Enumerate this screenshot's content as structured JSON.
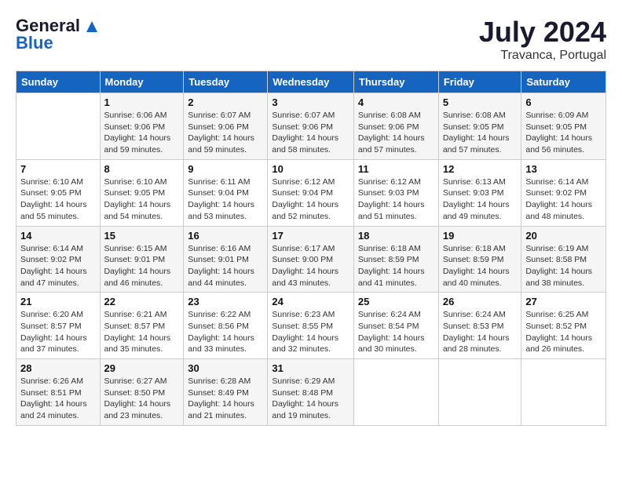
{
  "logo": {
    "line1": "General",
    "line2": "Blue"
  },
  "title": "July 2024",
  "location": "Travanca, Portugal",
  "days_of_week": [
    "Sunday",
    "Monday",
    "Tuesday",
    "Wednesday",
    "Thursday",
    "Friday",
    "Saturday"
  ],
  "weeks": [
    [
      {
        "day": "",
        "sunrise": "",
        "sunset": "",
        "daylight": ""
      },
      {
        "day": "1",
        "sunrise": "Sunrise: 6:06 AM",
        "sunset": "Sunset: 9:06 PM",
        "daylight": "Daylight: 14 hours and 59 minutes."
      },
      {
        "day": "2",
        "sunrise": "Sunrise: 6:07 AM",
        "sunset": "Sunset: 9:06 PM",
        "daylight": "Daylight: 14 hours and 59 minutes."
      },
      {
        "day": "3",
        "sunrise": "Sunrise: 6:07 AM",
        "sunset": "Sunset: 9:06 PM",
        "daylight": "Daylight: 14 hours and 58 minutes."
      },
      {
        "day": "4",
        "sunrise": "Sunrise: 6:08 AM",
        "sunset": "Sunset: 9:06 PM",
        "daylight": "Daylight: 14 hours and 57 minutes."
      },
      {
        "day": "5",
        "sunrise": "Sunrise: 6:08 AM",
        "sunset": "Sunset: 9:05 PM",
        "daylight": "Daylight: 14 hours and 57 minutes."
      },
      {
        "day": "6",
        "sunrise": "Sunrise: 6:09 AM",
        "sunset": "Sunset: 9:05 PM",
        "daylight": "Daylight: 14 hours and 56 minutes."
      }
    ],
    [
      {
        "day": "7",
        "sunrise": "Sunrise: 6:10 AM",
        "sunset": "Sunset: 9:05 PM",
        "daylight": "Daylight: 14 hours and 55 minutes."
      },
      {
        "day": "8",
        "sunrise": "Sunrise: 6:10 AM",
        "sunset": "Sunset: 9:05 PM",
        "daylight": "Daylight: 14 hours and 54 minutes."
      },
      {
        "day": "9",
        "sunrise": "Sunrise: 6:11 AM",
        "sunset": "Sunset: 9:04 PM",
        "daylight": "Daylight: 14 hours and 53 minutes."
      },
      {
        "day": "10",
        "sunrise": "Sunrise: 6:12 AM",
        "sunset": "Sunset: 9:04 PM",
        "daylight": "Daylight: 14 hours and 52 minutes."
      },
      {
        "day": "11",
        "sunrise": "Sunrise: 6:12 AM",
        "sunset": "Sunset: 9:03 PM",
        "daylight": "Daylight: 14 hours and 51 minutes."
      },
      {
        "day": "12",
        "sunrise": "Sunrise: 6:13 AM",
        "sunset": "Sunset: 9:03 PM",
        "daylight": "Daylight: 14 hours and 49 minutes."
      },
      {
        "day": "13",
        "sunrise": "Sunrise: 6:14 AM",
        "sunset": "Sunset: 9:02 PM",
        "daylight": "Daylight: 14 hours and 48 minutes."
      }
    ],
    [
      {
        "day": "14",
        "sunrise": "Sunrise: 6:14 AM",
        "sunset": "Sunset: 9:02 PM",
        "daylight": "Daylight: 14 hours and 47 minutes."
      },
      {
        "day": "15",
        "sunrise": "Sunrise: 6:15 AM",
        "sunset": "Sunset: 9:01 PM",
        "daylight": "Daylight: 14 hours and 46 minutes."
      },
      {
        "day": "16",
        "sunrise": "Sunrise: 6:16 AM",
        "sunset": "Sunset: 9:01 PM",
        "daylight": "Daylight: 14 hours and 44 minutes."
      },
      {
        "day": "17",
        "sunrise": "Sunrise: 6:17 AM",
        "sunset": "Sunset: 9:00 PM",
        "daylight": "Daylight: 14 hours and 43 minutes."
      },
      {
        "day": "18",
        "sunrise": "Sunrise: 6:18 AM",
        "sunset": "Sunset: 8:59 PM",
        "daylight": "Daylight: 14 hours and 41 minutes."
      },
      {
        "day": "19",
        "sunrise": "Sunrise: 6:18 AM",
        "sunset": "Sunset: 8:59 PM",
        "daylight": "Daylight: 14 hours and 40 minutes."
      },
      {
        "day": "20",
        "sunrise": "Sunrise: 6:19 AM",
        "sunset": "Sunset: 8:58 PM",
        "daylight": "Daylight: 14 hours and 38 minutes."
      }
    ],
    [
      {
        "day": "21",
        "sunrise": "Sunrise: 6:20 AM",
        "sunset": "Sunset: 8:57 PM",
        "daylight": "Daylight: 14 hours and 37 minutes."
      },
      {
        "day": "22",
        "sunrise": "Sunrise: 6:21 AM",
        "sunset": "Sunset: 8:57 PM",
        "daylight": "Daylight: 14 hours and 35 minutes."
      },
      {
        "day": "23",
        "sunrise": "Sunrise: 6:22 AM",
        "sunset": "Sunset: 8:56 PM",
        "daylight": "Daylight: 14 hours and 33 minutes."
      },
      {
        "day": "24",
        "sunrise": "Sunrise: 6:23 AM",
        "sunset": "Sunset: 8:55 PM",
        "daylight": "Daylight: 14 hours and 32 minutes."
      },
      {
        "day": "25",
        "sunrise": "Sunrise: 6:24 AM",
        "sunset": "Sunset: 8:54 PM",
        "daylight": "Daylight: 14 hours and 30 minutes."
      },
      {
        "day": "26",
        "sunrise": "Sunrise: 6:24 AM",
        "sunset": "Sunset: 8:53 PM",
        "daylight": "Daylight: 14 hours and 28 minutes."
      },
      {
        "day": "27",
        "sunrise": "Sunrise: 6:25 AM",
        "sunset": "Sunset: 8:52 PM",
        "daylight": "Daylight: 14 hours and 26 minutes."
      }
    ],
    [
      {
        "day": "28",
        "sunrise": "Sunrise: 6:26 AM",
        "sunset": "Sunset: 8:51 PM",
        "daylight": "Daylight: 14 hours and 24 minutes."
      },
      {
        "day": "29",
        "sunrise": "Sunrise: 6:27 AM",
        "sunset": "Sunset: 8:50 PM",
        "daylight": "Daylight: 14 hours and 23 minutes."
      },
      {
        "day": "30",
        "sunrise": "Sunrise: 6:28 AM",
        "sunset": "Sunset: 8:49 PM",
        "daylight": "Daylight: 14 hours and 21 minutes."
      },
      {
        "day": "31",
        "sunrise": "Sunrise: 6:29 AM",
        "sunset": "Sunset: 8:48 PM",
        "daylight": "Daylight: 14 hours and 19 minutes."
      },
      {
        "day": "",
        "sunrise": "",
        "sunset": "",
        "daylight": ""
      },
      {
        "day": "",
        "sunrise": "",
        "sunset": "",
        "daylight": ""
      },
      {
        "day": "",
        "sunrise": "",
        "sunset": "",
        "daylight": ""
      }
    ]
  ]
}
